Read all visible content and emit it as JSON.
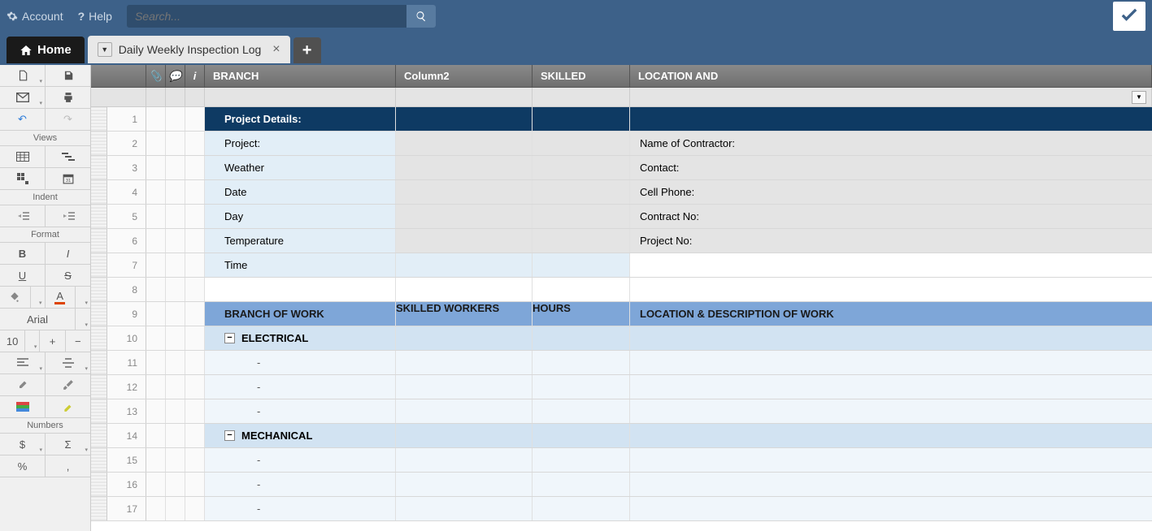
{
  "topbar": {
    "account": "Account",
    "help": "Help",
    "search_placeholder": "Search..."
  },
  "tabs": {
    "home": "Home",
    "sheet": "Daily Weekly Inspection Log"
  },
  "sidebar": {
    "views": "Views",
    "indent": "Indent",
    "format": "Format",
    "font": "Arial",
    "fontsize": "10",
    "numbers": "Numbers"
  },
  "columns": {
    "branch": "BRANCH",
    "col2": "Column2",
    "skilled": "SKILLED",
    "location": "LOCATION AND"
  },
  "rows": [
    {
      "n": "1",
      "type": "header-dark",
      "branch": "Project Details:",
      "loc": ""
    },
    {
      "n": "2",
      "type": "lightblue gray",
      "branch": "Project:",
      "loc": "Name of Contractor:"
    },
    {
      "n": "3",
      "type": "lightblue gray",
      "branch": "Weather",
      "loc": "Contact:"
    },
    {
      "n": "4",
      "type": "lightblue gray",
      "branch": "Date",
      "loc": "Cell Phone:"
    },
    {
      "n": "5",
      "type": "lightblue gray",
      "branch": "Day",
      "loc": "Contract No:"
    },
    {
      "n": "6",
      "type": "lightblue gray",
      "branch": "Temperature",
      "loc": "Project No:"
    },
    {
      "n": "7",
      "type": "lightblue",
      "branch": "Time",
      "loc": ""
    },
    {
      "n": "8",
      "type": "",
      "branch": "",
      "loc": ""
    },
    {
      "n": "9",
      "type": "subheader",
      "branch": "BRANCH OF WORK",
      "col2": "SKILLED WORKERS",
      "skilled": "HOURS",
      "loc": "LOCATION & DESCRIPTION OF WORK"
    },
    {
      "n": "10",
      "type": "section",
      "branch": "ELECTRICAL",
      "collapse": true
    },
    {
      "n": "11",
      "type": "blank-light",
      "branch": "-",
      "indent": true
    },
    {
      "n": "12",
      "type": "blank-light",
      "branch": "-",
      "indent": true
    },
    {
      "n": "13",
      "type": "blank-light",
      "branch": "-",
      "indent": true
    },
    {
      "n": "14",
      "type": "section",
      "branch": "MECHANICAL",
      "collapse": true
    },
    {
      "n": "15",
      "type": "blank-light",
      "branch": "-",
      "indent": true
    },
    {
      "n": "16",
      "type": "blank-light",
      "branch": "-",
      "indent": true
    },
    {
      "n": "17",
      "type": "blank-light",
      "branch": "-",
      "indent": true
    }
  ]
}
